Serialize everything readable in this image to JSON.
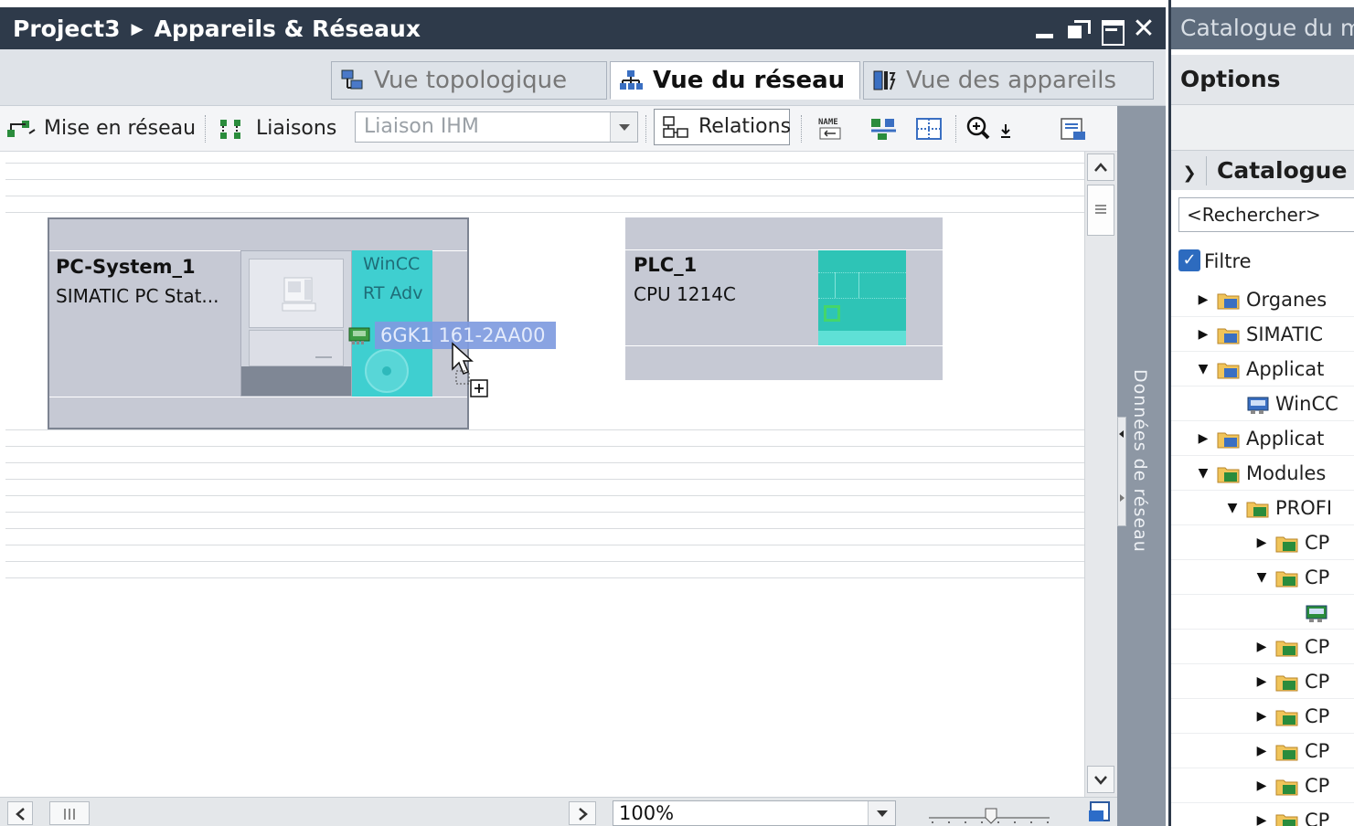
{
  "editor": {
    "breadcrumb": {
      "project": "Project3",
      "page": "Appareils & Réseaux"
    },
    "view_tabs": [
      {
        "label": "Vue topologique",
        "active": false
      },
      {
        "label": "Vue du réseau",
        "active": true
      },
      {
        "label": "Vue des appareils",
        "active": false
      }
    ],
    "toolbar": {
      "networking": "Mise en réseau",
      "connections": "Liaisons",
      "connection_type": "Liaison IHM",
      "relations": "Relations",
      "name_icon_text": "NAME"
    },
    "devices": [
      {
        "name": "PC-System_1",
        "type": "SIMATIC PC Stat...",
        "app_line1": "WinCC",
        "app_line2": "RT Adv",
        "dragged_module": "6GK1 161-2AA00"
      },
      {
        "name": "PLC_1",
        "type": "CPU 1214C"
      }
    ],
    "side_panel_label": "Données de réseau",
    "zoom": "100%"
  },
  "catalog": {
    "title": "Catalogue du matériel",
    "options": "Options",
    "section": "Catalogue",
    "search_placeholder": "<Rechercher>",
    "filter_label": "Filtre",
    "filter_checked": true,
    "tree": [
      {
        "label": "Organes",
        "level": 0,
        "state": "collapsed"
      },
      {
        "label": "SIMATIC",
        "level": 0,
        "state": "collapsed"
      },
      {
        "label": "Applicat",
        "level": 0,
        "state": "expanded"
      },
      {
        "label": "WinCC",
        "level": 1,
        "state": "leaf"
      },
      {
        "label": "Applicat",
        "level": 0,
        "state": "collapsed"
      },
      {
        "label": "Modules",
        "level": 0,
        "state": "expanded"
      },
      {
        "label": "PROFI",
        "level": 1,
        "state": "expanded"
      },
      {
        "label": "CP",
        "level": 2,
        "state": "collapsed"
      },
      {
        "label": "CP",
        "level": 2,
        "state": "expanded"
      },
      {
        "label": "",
        "level": 3,
        "state": "leaf"
      },
      {
        "label": "CP",
        "level": 2,
        "state": "collapsed"
      },
      {
        "label": "CP",
        "level": 2,
        "state": "collapsed"
      },
      {
        "label": "CP",
        "level": 2,
        "state": "collapsed"
      },
      {
        "label": "CP",
        "level": 2,
        "state": "collapsed"
      },
      {
        "label": "CP",
        "level": 2,
        "state": "collapsed"
      },
      {
        "label": "CP",
        "level": 2,
        "state": "collapsed"
      }
    ]
  },
  "colors": {
    "title_bar": "#2e3a4a",
    "device_box": "#c6c9d4",
    "module_teal": "#3fcfd0",
    "plc_green": "#2ec4b6",
    "selection_blue": "#7f9be0"
  }
}
